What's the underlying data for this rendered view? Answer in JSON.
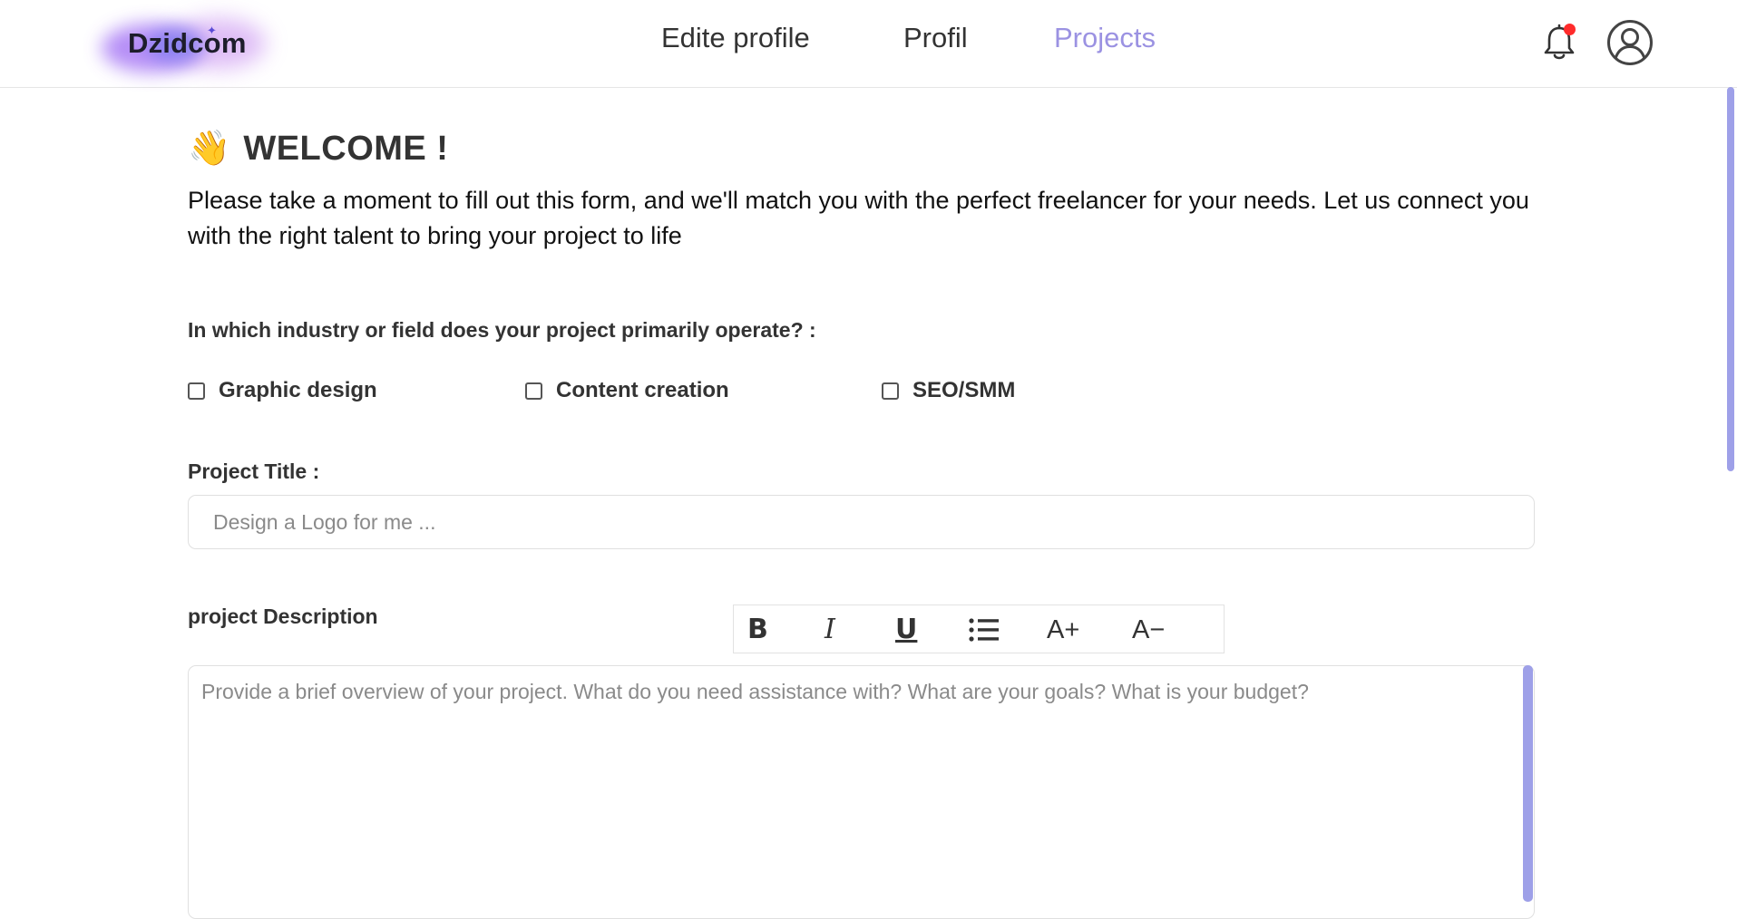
{
  "brand": {
    "name": "Dzidcom"
  },
  "nav": {
    "links": [
      {
        "label": "Edite profile",
        "active": false
      },
      {
        "label": "Profil",
        "active": false
      },
      {
        "label": "Projects",
        "active": true
      }
    ],
    "notification_dot": true,
    "bell_icon": "bell-icon",
    "avatar_icon": "user-circle-icon"
  },
  "welcome": {
    "emoji": "👋",
    "title": "WELCOME !",
    "intro": "Please take a moment to fill out this form, and we'll match you with the perfect freelancer for your needs. Let us connect you with the right talent to bring your project to life"
  },
  "form": {
    "industry_question": "In which industry or field does your project primarily operate? :",
    "industry_options": [
      {
        "label": "Graphic design",
        "checked": false
      },
      {
        "label": "Content creation",
        "checked": false
      },
      {
        "label": "SEO/SMM",
        "checked": false
      }
    ],
    "title_label": "Project Title :",
    "title_value": "",
    "title_placeholder": "Design a Logo for me ...",
    "description_label": "project Description",
    "description_value": "",
    "description_placeholder": "Provide a brief overview of your project. What do you need assistance with? What are your goals? What is your budget?",
    "toolbar": {
      "bold": "B",
      "italic": "I",
      "underline": "U",
      "list_icon": "list-icon",
      "increase_font": "A+",
      "decrease_font": "A−"
    }
  },
  "colors": {
    "accent": "#9b92e2",
    "scrollbar": "#9ea0e8",
    "notification": "#ff2b2b"
  }
}
